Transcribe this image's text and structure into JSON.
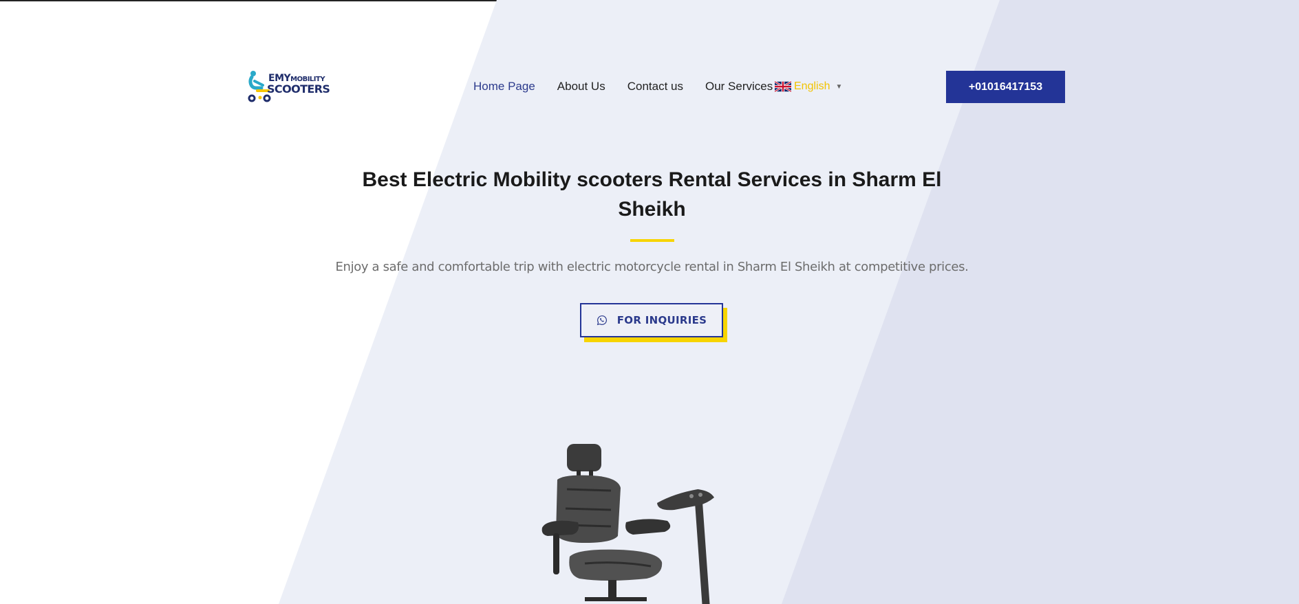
{
  "brand": {
    "logo_top": "EMY",
    "logo_top_small": "MOBILITY",
    "logo_bottom": "SCOOTERS"
  },
  "nav": {
    "items": [
      {
        "label": "Home Page",
        "active": true
      },
      {
        "label": "About Us"
      },
      {
        "label": "Contact us"
      },
      {
        "label": "Our Services"
      }
    ],
    "language": "English"
  },
  "header": {
    "phone": "+01016417153"
  },
  "hero": {
    "title": "Best Electric Mobility scooters Rental Services in Sharm El Sheikh",
    "subtitle": "Enjoy a safe and comfortable trip with electric motorcycle rental in Sharm El Sheikh at competitive prices.",
    "cta_label": "FOR INQUIRIES"
  },
  "colors": {
    "primary": "#233497",
    "accent": "#f7d400",
    "bg_light": "#eceff7",
    "bg_mid": "#dfe2f0"
  },
  "icons": {
    "cta": "whatsapp-icon",
    "language": "uk-flag-icon",
    "dropdown": "caret-down-icon"
  }
}
